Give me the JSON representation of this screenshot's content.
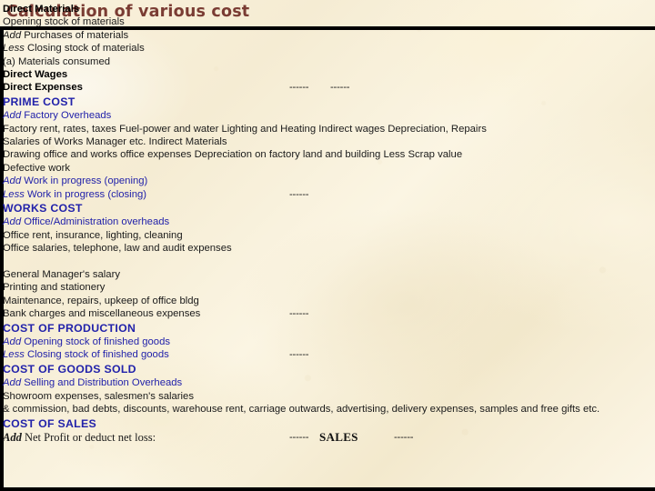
{
  "slide": {
    "title": "Calculation of various cost",
    "title_color": "#7a3c33",
    "heading_color": "#2222aa",
    "body_color": "#1a1a1a",
    "background_color": "#f7efd9",
    "border_color": "#000000"
  },
  "dashes": {
    "short": "------"
  },
  "lines": [
    {
      "text": "Direct Materials"
    },
    {
      "text": "Opening stock of materials"
    },
    {
      "lead": "Add",
      "text": "Purchases of materials"
    },
    {
      "lead": "Less",
      "text": "Closing stock of materials"
    },
    {
      "text": "(a)  Materials consumed"
    },
    {
      "text": "Direct Wages"
    },
    {
      "text": "Direct Expenses",
      "dash1": "------",
      "dash2": "------"
    },
    {
      "text": "PRIME COST"
    },
    {
      "lead": "Add",
      "text": "Factory Overheads"
    },
    {
      "text": "Factory rent, rates, taxes Fuel-power and water Lighting and Heating Indirect wages Depreciation, Repairs"
    },
    {
      "text": "Salaries of Works Manager etc. Indirect Materials"
    },
    {
      "text": "Drawing office and works office expenses Depreciation on factory land and building Less Scrap value"
    },
    {
      "text": "Defective work"
    },
    {
      "lead": "Add",
      "text": "Work in progress (opening)"
    },
    {
      "lead": "Less",
      "text": "Work in progress (closing)",
      "dash1": "------"
    },
    {
      "text": "WORKS COST"
    },
    {
      "lead": "Add",
      "text": "Office/Administration overheads"
    },
    {
      "text": "Office rent, insurance, lighting, cleaning"
    },
    {
      "text": "Office salaries, telephone, law and audit expenses"
    },
    {
      "text": ""
    },
    {
      "text": "General Manager's salary"
    },
    {
      "text": "Printing and stationery"
    },
    {
      "text": "Maintenance, repairs, upkeep of office bldg"
    },
    {
      "text": "Bank charges and miscellaneous expenses",
      "dash1": "------"
    },
    {
      "text": "COST OF PRODUCTION"
    },
    {
      "lead": "Add",
      "text": "Opening stock of finished goods"
    },
    {
      "lead": "Less",
      "text": "Closing stock of finished goods",
      "dash1": "------"
    },
    {
      "text": "COST OF GOODS SOLD"
    },
    {
      "lead": "Add",
      "text": "Selling and Distribution Overheads"
    },
    {
      "text": "Showroom expenses, salesmen's salaries"
    },
    {
      "text": "& commission, bad debts, discounts, warehouse rent, carriage outwards, advertising, delivery expenses, samples and free gifts etc."
    },
    {
      "text": "COST OF SALES"
    },
    {
      "lead": "Add",
      "text": "Net Profit or deduct net loss:",
      "dash1": "------",
      "sales": "SALES",
      "dash_sales": "------"
    }
  ]
}
